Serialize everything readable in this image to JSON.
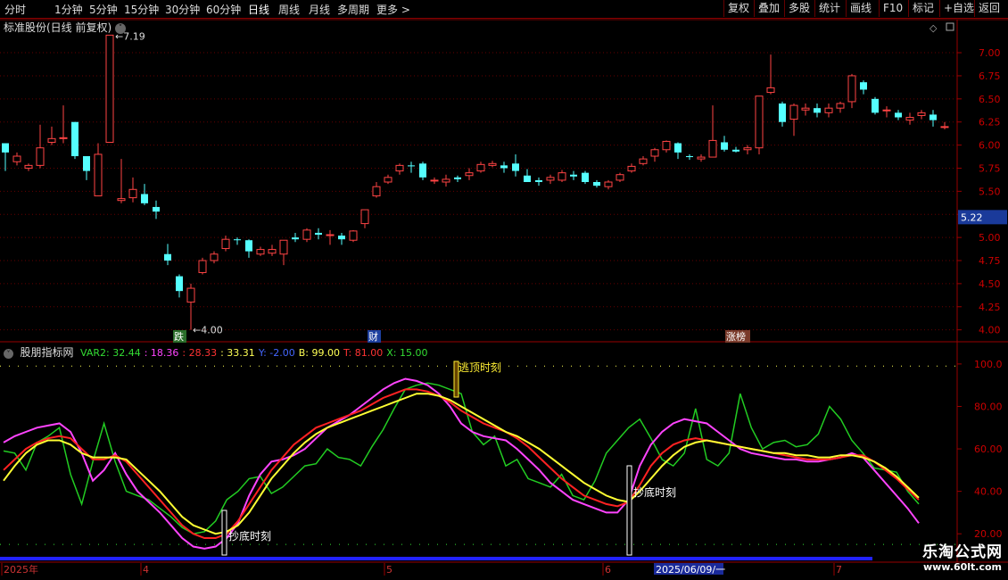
{
  "toolbar": {
    "periods": [
      {
        "label": "分时",
        "active": false
      },
      {
        "label": "1分钟",
        "active": false
      },
      {
        "label": "5分钟",
        "active": false
      },
      {
        "label": "15分钟",
        "active": false
      },
      {
        "label": "30分钟",
        "active": false
      },
      {
        "label": "60分钟",
        "active": false
      },
      {
        "label": "日线",
        "active": true
      },
      {
        "label": "周线",
        "active": false
      },
      {
        "label": "月线",
        "active": false
      },
      {
        "label": "多周期",
        "active": false
      },
      {
        "label": "更多 >",
        "active": false
      }
    ],
    "actions": [
      "复权",
      "叠加",
      "多股",
      "统计",
      "画线",
      "F10",
      "标记",
      "+自选",
      "返回"
    ]
  },
  "main_panel": {
    "title": "标准股份(日线 前复权)",
    "high_label": "7.19",
    "low_label": "4.00",
    "current_price": "5.22",
    "markers": [
      "跌",
      "财",
      "涨榜"
    ]
  },
  "indicator_panel": {
    "name": "股朋指标网",
    "legend": [
      {
        "text": "VAR2: 32.44",
        "color": "#33dd33"
      },
      {
        "text": ": 18.36",
        "color": "#ff44ff"
      },
      {
        "text": ": 28.33",
        "color": "#ff3333"
      },
      {
        "text": ": 33.31",
        "color": "#ffff55"
      },
      {
        "text": "Y: -2.00",
        "color": "#4466ff"
      },
      {
        "text": "B: 99.00",
        "color": "#ffff55"
      },
      {
        "text": "T: 81.00",
        "color": "#ff3333"
      },
      {
        "text": "X: 15.00",
        "color": "#33dd33"
      }
    ],
    "annotations": [
      "逃顶时刻",
      "抄底时刻",
      "抄底时刻"
    ]
  },
  "x_axis": {
    "labels": [
      "2025年",
      "4",
      "5",
      "6",
      "7"
    ],
    "cursor_date": "2025/06/09/一"
  },
  "watermark": {
    "line1": "乐淘公式网",
    "line2": "www.60lt.com"
  },
  "chart_data": [
    {
      "type": "candlestick",
      "title": "标准股份(日线 前复权)",
      "y_ticks": [
        "7.00",
        "6.75",
        "6.50",
        "6.25",
        "6.00",
        "5.75",
        "5.50",
        "5.25",
        "5.00",
        "4.75",
        "4.50",
        "4.25",
        "4.00"
      ],
      "ylim": [
        3.9,
        7.3
      ],
      "candles": [
        [
          6.02,
          5.92,
          6.0,
          5.72
        ],
        [
          5.82,
          5.88,
          5.92,
          5.78
        ],
        [
          5.75,
          5.78,
          5.8,
          5.72
        ],
        [
          5.78,
          5.97,
          6.22,
          5.75
        ],
        [
          6.03,
          6.07,
          6.2,
          6.0
        ],
        [
          6.07,
          6.08,
          6.43,
          6.02
        ],
        [
          6.25,
          5.88,
          6.25,
          5.85
        ],
        [
          5.88,
          5.72,
          5.82,
          5.62
        ],
        [
          5.45,
          5.9,
          6.02,
          5.45
        ],
        [
          6.03,
          7.19,
          7.19,
          6.03
        ],
        [
          5.4,
          5.42,
          5.85,
          5.37
        ],
        [
          5.43,
          5.52,
          5.65,
          5.38
        ],
        [
          5.47,
          5.37,
          5.58,
          5.35
        ],
        [
          5.33,
          5.28,
          5.4,
          5.2
        ],
        [
          4.82,
          4.75,
          4.93,
          4.7
        ],
        [
          4.58,
          4.42,
          4.6,
          4.35
        ],
        [
          4.3,
          4.45,
          4.5,
          4.0
        ],
        [
          4.62,
          4.75,
          4.78,
          4.6
        ],
        [
          4.75,
          4.82,
          4.85,
          4.72
        ],
        [
          4.88,
          4.98,
          5.02,
          4.85
        ],
        [
          4.98,
          4.97,
          5.0,
          4.92
        ],
        [
          4.97,
          4.85,
          4.98,
          4.78
        ],
        [
          4.82,
          4.87,
          4.9,
          4.8
        ],
        [
          4.83,
          4.87,
          4.92,
          4.8
        ],
        [
          4.82,
          4.97,
          4.97,
          4.7
        ],
        [
          5.0,
          4.98,
          5.05,
          4.95
        ],
        [
          4.98,
          5.08,
          5.1,
          4.95
        ],
        [
          5.05,
          5.03,
          5.1,
          4.98
        ],
        [
          5.03,
          5.03,
          5.08,
          4.92
        ],
        [
          5.02,
          4.98,
          5.05,
          4.92
        ],
        [
          4.97,
          5.07,
          5.08,
          4.95
        ],
        [
          5.15,
          5.3,
          5.3,
          5.1
        ],
        [
          5.45,
          5.55,
          5.6,
          5.43
        ],
        [
          5.6,
          5.65,
          5.68,
          5.58
        ],
        [
          5.72,
          5.78,
          5.8,
          5.68
        ],
        [
          5.78,
          5.77,
          5.82,
          5.7
        ],
        [
          5.8,
          5.65,
          5.82,
          5.62
        ],
        [
          5.62,
          5.62,
          5.65,
          5.58
        ],
        [
          5.6,
          5.63,
          5.68,
          5.55
        ],
        [
          5.65,
          5.63,
          5.67,
          5.6
        ],
        [
          5.67,
          5.7,
          5.75,
          5.62
        ],
        [
          5.72,
          5.79,
          5.82,
          5.7
        ],
        [
          5.78,
          5.8,
          5.83,
          5.76
        ],
        [
          5.78,
          5.75,
          5.82,
          5.7
        ],
        [
          5.8,
          5.72,
          5.9,
          5.66
        ],
        [
          5.67,
          5.6,
          5.74,
          5.6
        ],
        [
          5.62,
          5.6,
          5.65,
          5.56
        ],
        [
          5.62,
          5.65,
          5.68,
          5.58
        ],
        [
          5.62,
          5.7,
          5.73,
          5.6
        ],
        [
          5.68,
          5.66,
          5.72,
          5.62
        ],
        [
          5.7,
          5.6,
          5.72,
          5.58
        ],
        [
          5.6,
          5.56,
          5.62,
          5.54
        ],
        [
          5.55,
          5.6,
          5.62,
          5.52
        ],
        [
          5.62,
          5.68,
          5.7,
          5.6
        ],
        [
          5.72,
          5.77,
          5.8,
          5.7
        ],
        [
          5.8,
          5.85,
          5.88,
          5.78
        ],
        [
          5.88,
          5.95,
          5.97,
          5.82
        ],
        [
          5.95,
          6.04,
          6.05,
          5.92
        ],
        [
          6.02,
          5.92,
          6.03,
          5.85
        ],
        [
          5.88,
          5.87,
          5.9,
          5.84
        ],
        [
          5.85,
          5.87,
          5.9,
          5.82
        ],
        [
          5.87,
          6.05,
          6.43,
          5.87
        ],
        [
          6.03,
          5.95,
          6.1,
          5.93
        ],
        [
          5.95,
          5.93,
          5.98,
          5.92
        ],
        [
          5.95,
          5.97,
          6.0,
          5.9
        ],
        [
          5.97,
          6.53,
          6.53,
          5.9
        ],
        [
          6.57,
          6.62,
          6.98,
          6.55
        ],
        [
          6.45,
          6.25,
          6.47,
          6.2
        ],
        [
          6.28,
          6.43,
          6.45,
          6.1
        ],
        [
          6.38,
          6.4,
          6.45,
          6.32
        ],
        [
          6.4,
          6.35,
          6.45,
          6.3
        ],
        [
          6.35,
          6.4,
          6.45,
          6.3
        ],
        [
          6.4,
          6.45,
          6.47,
          6.35
        ],
        [
          6.47,
          6.75,
          6.77,
          6.4
        ],
        [
          6.68,
          6.6,
          6.7,
          6.55
        ],
        [
          6.5,
          6.35,
          6.52,
          6.33
        ],
        [
          6.38,
          6.38,
          6.42,
          6.3
        ],
        [
          6.35,
          6.3,
          6.38,
          6.27
        ],
        [
          6.27,
          6.3,
          6.35,
          6.22
        ],
        [
          6.32,
          6.35,
          6.38,
          6.28
        ],
        [
          6.33,
          6.27,
          6.38,
          6.2
        ],
        [
          6.2,
          6.2,
          6.25,
          6.17
        ]
      ]
    },
    {
      "type": "line",
      "title": "股朋指标网",
      "y_ticks": [
        "100.0",
        "80.00",
        "60.00",
        "40.00",
        "20.00"
      ],
      "ylim": [
        10,
        105
      ],
      "series": [
        {
          "name": "VAR2",
          "color": "#22cc22",
          "values": [
            59,
            58,
            50,
            63,
            66,
            70,
            48,
            34,
            54,
            72,
            54,
            40,
            38,
            36,
            32,
            28,
            23,
            20,
            21,
            26,
            36,
            40,
            46,
            47,
            39,
            42,
            47,
            52,
            53,
            60,
            56,
            55,
            52,
            61,
            69,
            79,
            88,
            90,
            91,
            90,
            88,
            86,
            68,
            62,
            66,
            52,
            55,
            46,
            44,
            42,
            48,
            38,
            36,
            45,
            58,
            64,
            70,
            74,
            65,
            55,
            52,
            58,
            79,
            55,
            52,
            58,
            86,
            70,
            60,
            63,
            64,
            61,
            62,
            67,
            80,
            74,
            64,
            58,
            51,
            50,
            49,
            40,
            34
          ]
        },
        {
          "name": "",
          "color": "#ff44ff",
          "values": [
            63,
            66,
            68,
            70,
            71,
            72,
            68,
            58,
            45,
            50,
            58,
            48,
            40,
            35,
            30,
            24,
            18,
            14,
            13,
            14,
            18,
            25,
            38,
            48,
            54,
            55,
            57,
            60,
            65,
            70,
            73,
            76,
            80,
            84,
            88,
            91,
            93,
            92,
            90,
            86,
            80,
            72,
            68,
            66,
            65,
            64,
            60,
            55,
            50,
            44,
            40,
            36,
            34,
            32,
            30,
            30,
            36,
            52,
            62,
            68,
            72,
            74,
            73,
            72,
            68,
            64,
            60,
            58,
            57,
            56,
            55,
            55,
            54,
            54,
            55,
            56,
            58,
            56,
            50,
            44,
            38,
            32,
            25
          ]
        },
        {
          "name": "",
          "color": "#ff2222",
          "values": [
            50,
            55,
            60,
            63,
            65,
            66,
            65,
            60,
            55,
            55,
            57,
            54,
            48,
            42,
            36,
            30,
            24,
            20,
            18,
            18,
            20,
            26,
            34,
            42,
            50,
            56,
            62,
            66,
            70,
            72,
            74,
            76,
            78,
            81,
            84,
            86,
            88,
            88,
            87,
            85,
            82,
            78,
            75,
            72,
            70,
            68,
            65,
            61,
            56,
            51,
            46,
            42,
            38,
            36,
            34,
            33,
            35,
            43,
            52,
            58,
            62,
            64,
            65,
            64,
            63,
            62,
            61,
            60,
            59,
            58,
            57,
            56,
            55,
            55,
            55,
            56,
            57,
            57,
            54,
            50,
            46,
            41,
            36
          ]
        },
        {
          "name": "",
          "color": "#ffff33",
          "values": [
            45,
            52,
            58,
            62,
            64,
            64,
            62,
            58,
            56,
            56,
            56,
            55,
            50,
            45,
            40,
            34,
            28,
            24,
            22,
            20,
            21,
            24,
            30,
            38,
            46,
            52,
            58,
            63,
            67,
            70,
            72,
            74,
            76,
            78,
            80,
            82,
            84,
            86,
            86,
            85,
            83,
            80,
            77,
            74,
            71,
            68,
            66,
            63,
            60,
            56,
            52,
            48,
            44,
            41,
            38,
            36,
            35,
            40,
            46,
            52,
            57,
            61,
            63,
            64,
            63,
            62,
            61,
            60,
            59,
            58,
            58,
            57,
            57,
            56,
            56,
            57,
            57,
            56,
            54,
            51,
            47,
            42,
            37
          ]
        }
      ]
    }
  ]
}
